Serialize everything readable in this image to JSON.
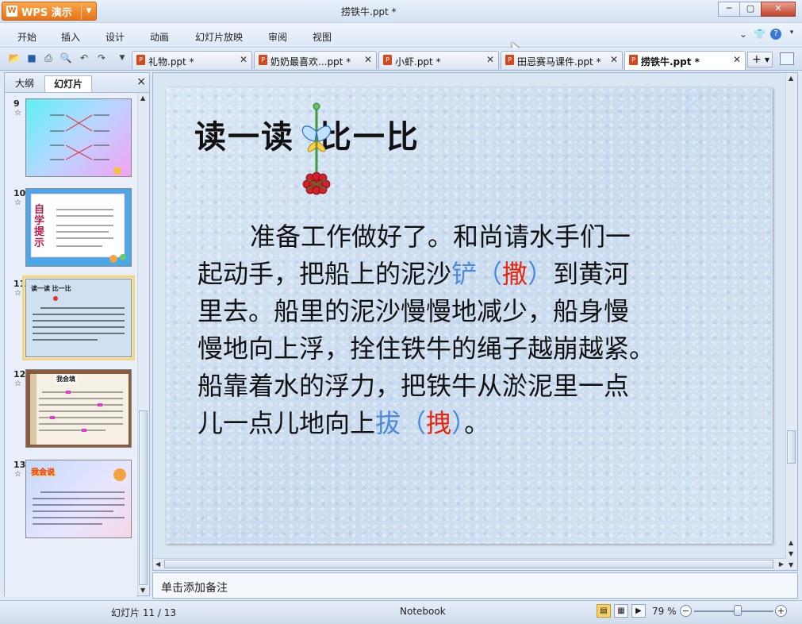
{
  "window": {
    "app_name": "WPS 演示",
    "title": "捞铁牛.ppt *",
    "controls": {
      "minimize": "─",
      "maximize": "▢",
      "close": "✕"
    }
  },
  "menu": {
    "items": [
      "开始",
      "插入",
      "设计",
      "动画",
      "幻灯片放映",
      "审阅",
      "视图"
    ],
    "right_icons": [
      "chevron-down-icon",
      "shirt-icon",
      "help-icon"
    ],
    "help_label": "?"
  },
  "toolbar": {
    "quick_access": [
      "open-icon",
      "save-icon",
      "print-icon",
      "print-preview-icon",
      "undo-icon",
      "redo-icon",
      "customize-icon"
    ],
    "tabs": [
      {
        "label": "礼物.ppt *",
        "active": false
      },
      {
        "label": "奶奶最喜欢...ppt *",
        "active": false
      },
      {
        "label": "小虾.ppt *",
        "active": false
      },
      {
        "label": "田忌赛马课件.ppt *",
        "active": false
      },
      {
        "label": "捞铁牛.ppt *",
        "active": true
      }
    ],
    "new_tab": "+"
  },
  "left_panel": {
    "tabs": [
      "大纲",
      "幻灯片"
    ],
    "active_tab": "幻灯片",
    "close": "×",
    "slides": [
      {
        "num": "9",
        "star": "☆",
        "bg": "cyan-pink"
      },
      {
        "num": "10",
        "star": "☆",
        "bg": "blue-frame",
        "title": "自学提示"
      },
      {
        "num": "11",
        "star": "☆",
        "bg": "light-blue",
        "title": "读一读 比一比",
        "selected": true
      },
      {
        "num": "12",
        "star": "☆",
        "bg": "brown-frame",
        "title": "我会填"
      },
      {
        "num": "13",
        "star": "☆",
        "bg": "gradient",
        "title": "我会说"
      }
    ]
  },
  "slide": {
    "title": "读一读  比一比",
    "body": {
      "line1": "准备工作做好了。和尚请水手们一",
      "line2_a": "起动手，把船上的泥沙",
      "line2_blue": "铲",
      "line2_paren_open": "（",
      "line2_red": "撒",
      "line2_paren_close": "）",
      "line2_b": "到黄河",
      "line3": "里去。船里的泥沙慢慢地减少，船身慢",
      "line4": "慢地向上浮，拴住铁牛的绳子越崩越紧。",
      "line5": "船靠着水的浮力，把铁牛从淤泥里一点",
      "line6_a": "儿一点儿地向上",
      "line6_blue": "拔",
      "line6_paren_open": "（",
      "line6_red": "拽",
      "line6_paren_close": "）",
      "line6_b": "。"
    },
    "colors": {
      "blue": "#4a8ad8",
      "red": "#e8240c"
    }
  },
  "notes": {
    "placeholder": "单击添加备注"
  },
  "status": {
    "slide_info": "幻灯片 11 / 13",
    "theme": "Notebook",
    "view_icons": [
      "normal-view-icon",
      "slide-sorter-icon",
      "slideshow-icon"
    ],
    "zoom": "79 %",
    "zoom_fraction": 0.55
  }
}
